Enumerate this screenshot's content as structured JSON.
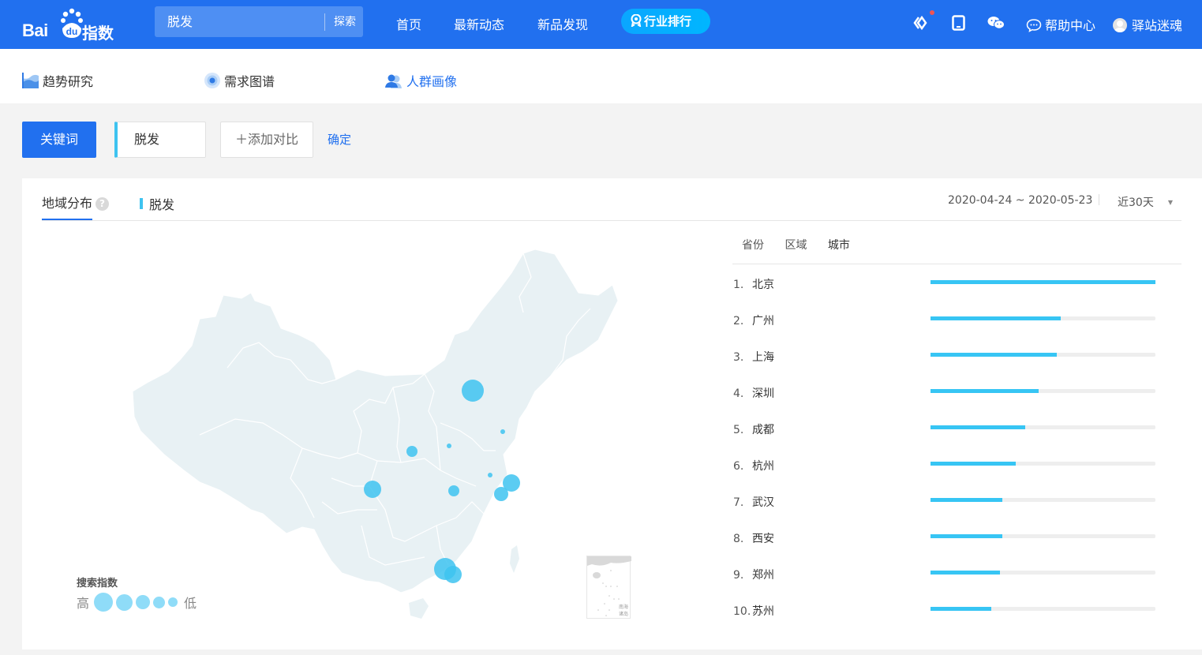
{
  "header": {
    "logo_text": "Bai",
    "logo_du": "du",
    "logo_zh": "指数",
    "search": {
      "value": "脱发",
      "button": "探索"
    },
    "nav": [
      "首页",
      "最新动态",
      "新品发现"
    ],
    "rank_pill": "行业排行",
    "help": "帮助中心",
    "user": "驿站迷魂",
    "icons": [
      "code-brackets-icon",
      "tablet-icon",
      "wechat-icon"
    ]
  },
  "subnav": {
    "items": [
      {
        "label": "趋势研究",
        "icon": "trend-chart-icon",
        "active": false
      },
      {
        "label": "需求图谱",
        "icon": "target-icon",
        "active": false
      },
      {
        "label": "人群画像",
        "icon": "people-icon",
        "active": true
      }
    ]
  },
  "toolbar": {
    "keyword_button": "关键词",
    "keyword_chip": "脱发",
    "add_compare": "＋添加对比",
    "confirm": "确定"
  },
  "panel": {
    "tab_title": "地域分布",
    "help_icon": "?",
    "legend_keyword": "脱发",
    "date_range": "2020-04-24 ~ 2020-05-23",
    "period": "近30天",
    "map": {
      "legend_title": "搜索指数",
      "legend_high": "高",
      "legend_low": "低",
      "inset_label_1": "南海",
      "inset_label_2": "诸岛",
      "bubbles": [
        {
          "city": "北京",
          "size_level": 1
        },
        {
          "city": "广州",
          "size_level": 1
        },
        {
          "city": "深圳",
          "size_level": 2
        },
        {
          "city": "上海",
          "size_level": 2
        },
        {
          "city": "杭州",
          "size_level": 3
        },
        {
          "city": "成都",
          "size_level": 2
        },
        {
          "city": "武汉",
          "size_level": 4
        },
        {
          "city": "西安",
          "size_level": 4
        },
        {
          "city": "郑州",
          "size_level": 5
        },
        {
          "city": "苏州",
          "size_level": 5
        },
        {
          "city": "青岛",
          "size_level": 5
        }
      ]
    },
    "rank_tabs": [
      "省份",
      "区域",
      "城市"
    ],
    "rank_active": "城市",
    "ranking": [
      {
        "rank": "1.",
        "city": "北京",
        "percent": 100
      },
      {
        "rank": "2.",
        "city": "广州",
        "percent": 58
      },
      {
        "rank": "3.",
        "city": "上海",
        "percent": 56
      },
      {
        "rank": "4.",
        "city": "深圳",
        "percent": 48
      },
      {
        "rank": "5.",
        "city": "成都",
        "percent": 42
      },
      {
        "rank": "6.",
        "city": "杭州",
        "percent": 38
      },
      {
        "rank": "7.",
        "city": "武汉",
        "percent": 32
      },
      {
        "rank": "8.",
        "city": "西安",
        "percent": 32
      },
      {
        "rank": "9.",
        "city": "郑州",
        "percent": 31
      },
      {
        "rank": "10.",
        "city": "苏州",
        "percent": 27
      }
    ]
  },
  "colors": {
    "brand": "#2170ef",
    "bar": "#37c5f4",
    "bubble": "#3ec3f0",
    "map_fill": "#e8f1f4"
  }
}
